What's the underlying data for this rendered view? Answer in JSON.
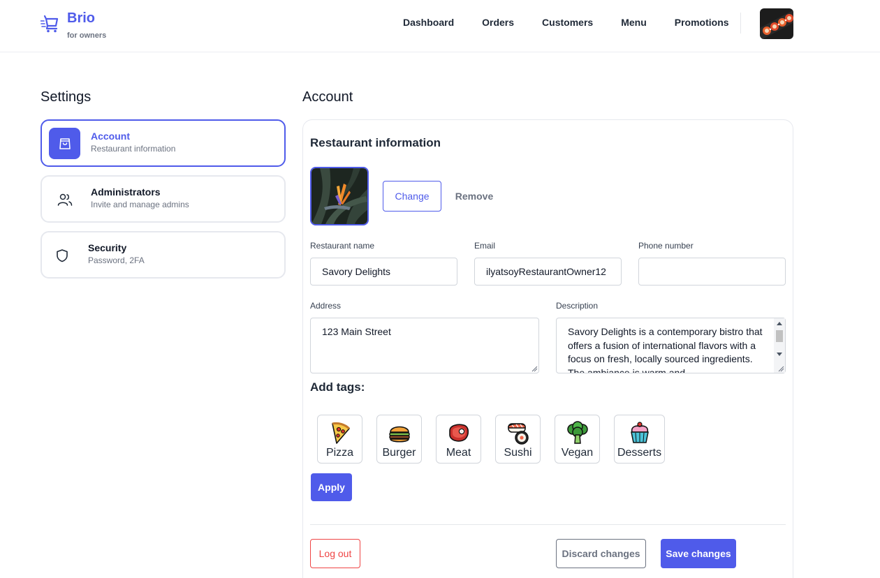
{
  "brand": {
    "name": "Brio",
    "subtitle": "for owners",
    "accent_color": "#4f5bea"
  },
  "nav": {
    "items": [
      {
        "label": "Dashboard"
      },
      {
        "label": "Orders"
      },
      {
        "label": "Customers"
      },
      {
        "label": "Menu"
      },
      {
        "label": "Promotions"
      }
    ],
    "avatar_icon": "sushi-roll-avatar"
  },
  "settings": {
    "title": "Settings",
    "items": [
      {
        "label": "Account",
        "description": "Restaurant information",
        "icon": "shopping-bag-icon",
        "active": true
      },
      {
        "label": "Administrators",
        "description": "Invite and manage admins",
        "icon": "users-icon",
        "active": false
      },
      {
        "label": "Security",
        "description": "Password, 2FA",
        "icon": "shield-icon",
        "active": false
      }
    ]
  },
  "account": {
    "title": "Account",
    "section_title": "Restaurant information",
    "photo_icon": "bird-of-paradise-flower-photo",
    "change_label": "Change",
    "remove_label": "Remove",
    "fields": {
      "name": {
        "label": "Restaurant name",
        "value": "Savory Delights"
      },
      "email": {
        "label": "Email",
        "value": "ilyatsoyRestaurantOwner12"
      },
      "phone": {
        "label": "Phone number",
        "value": ""
      },
      "address": {
        "label": "Address",
        "value": "123 Main Street"
      },
      "description": {
        "label": "Description",
        "value": "Savory Delights is a contemporary bistro that offers a fusion of international flavors with a focus on fresh, locally sourced ingredients. The ambiance is warm and"
      }
    },
    "tags_title": "Add tags:",
    "tags": [
      {
        "label": "Pizza",
        "icon": "pizza-icon"
      },
      {
        "label": "Burger",
        "icon": "burger-icon"
      },
      {
        "label": "Meat",
        "icon": "meat-icon"
      },
      {
        "label": "Sushi",
        "icon": "sushi-icon"
      },
      {
        "label": "Vegan",
        "icon": "broccoli-icon"
      },
      {
        "label": "Desserts",
        "icon": "cupcake-icon"
      }
    ],
    "apply_label": "Apply",
    "logout_label": "Log out",
    "discard_label": "Discard changes",
    "save_label": "Save changes"
  }
}
